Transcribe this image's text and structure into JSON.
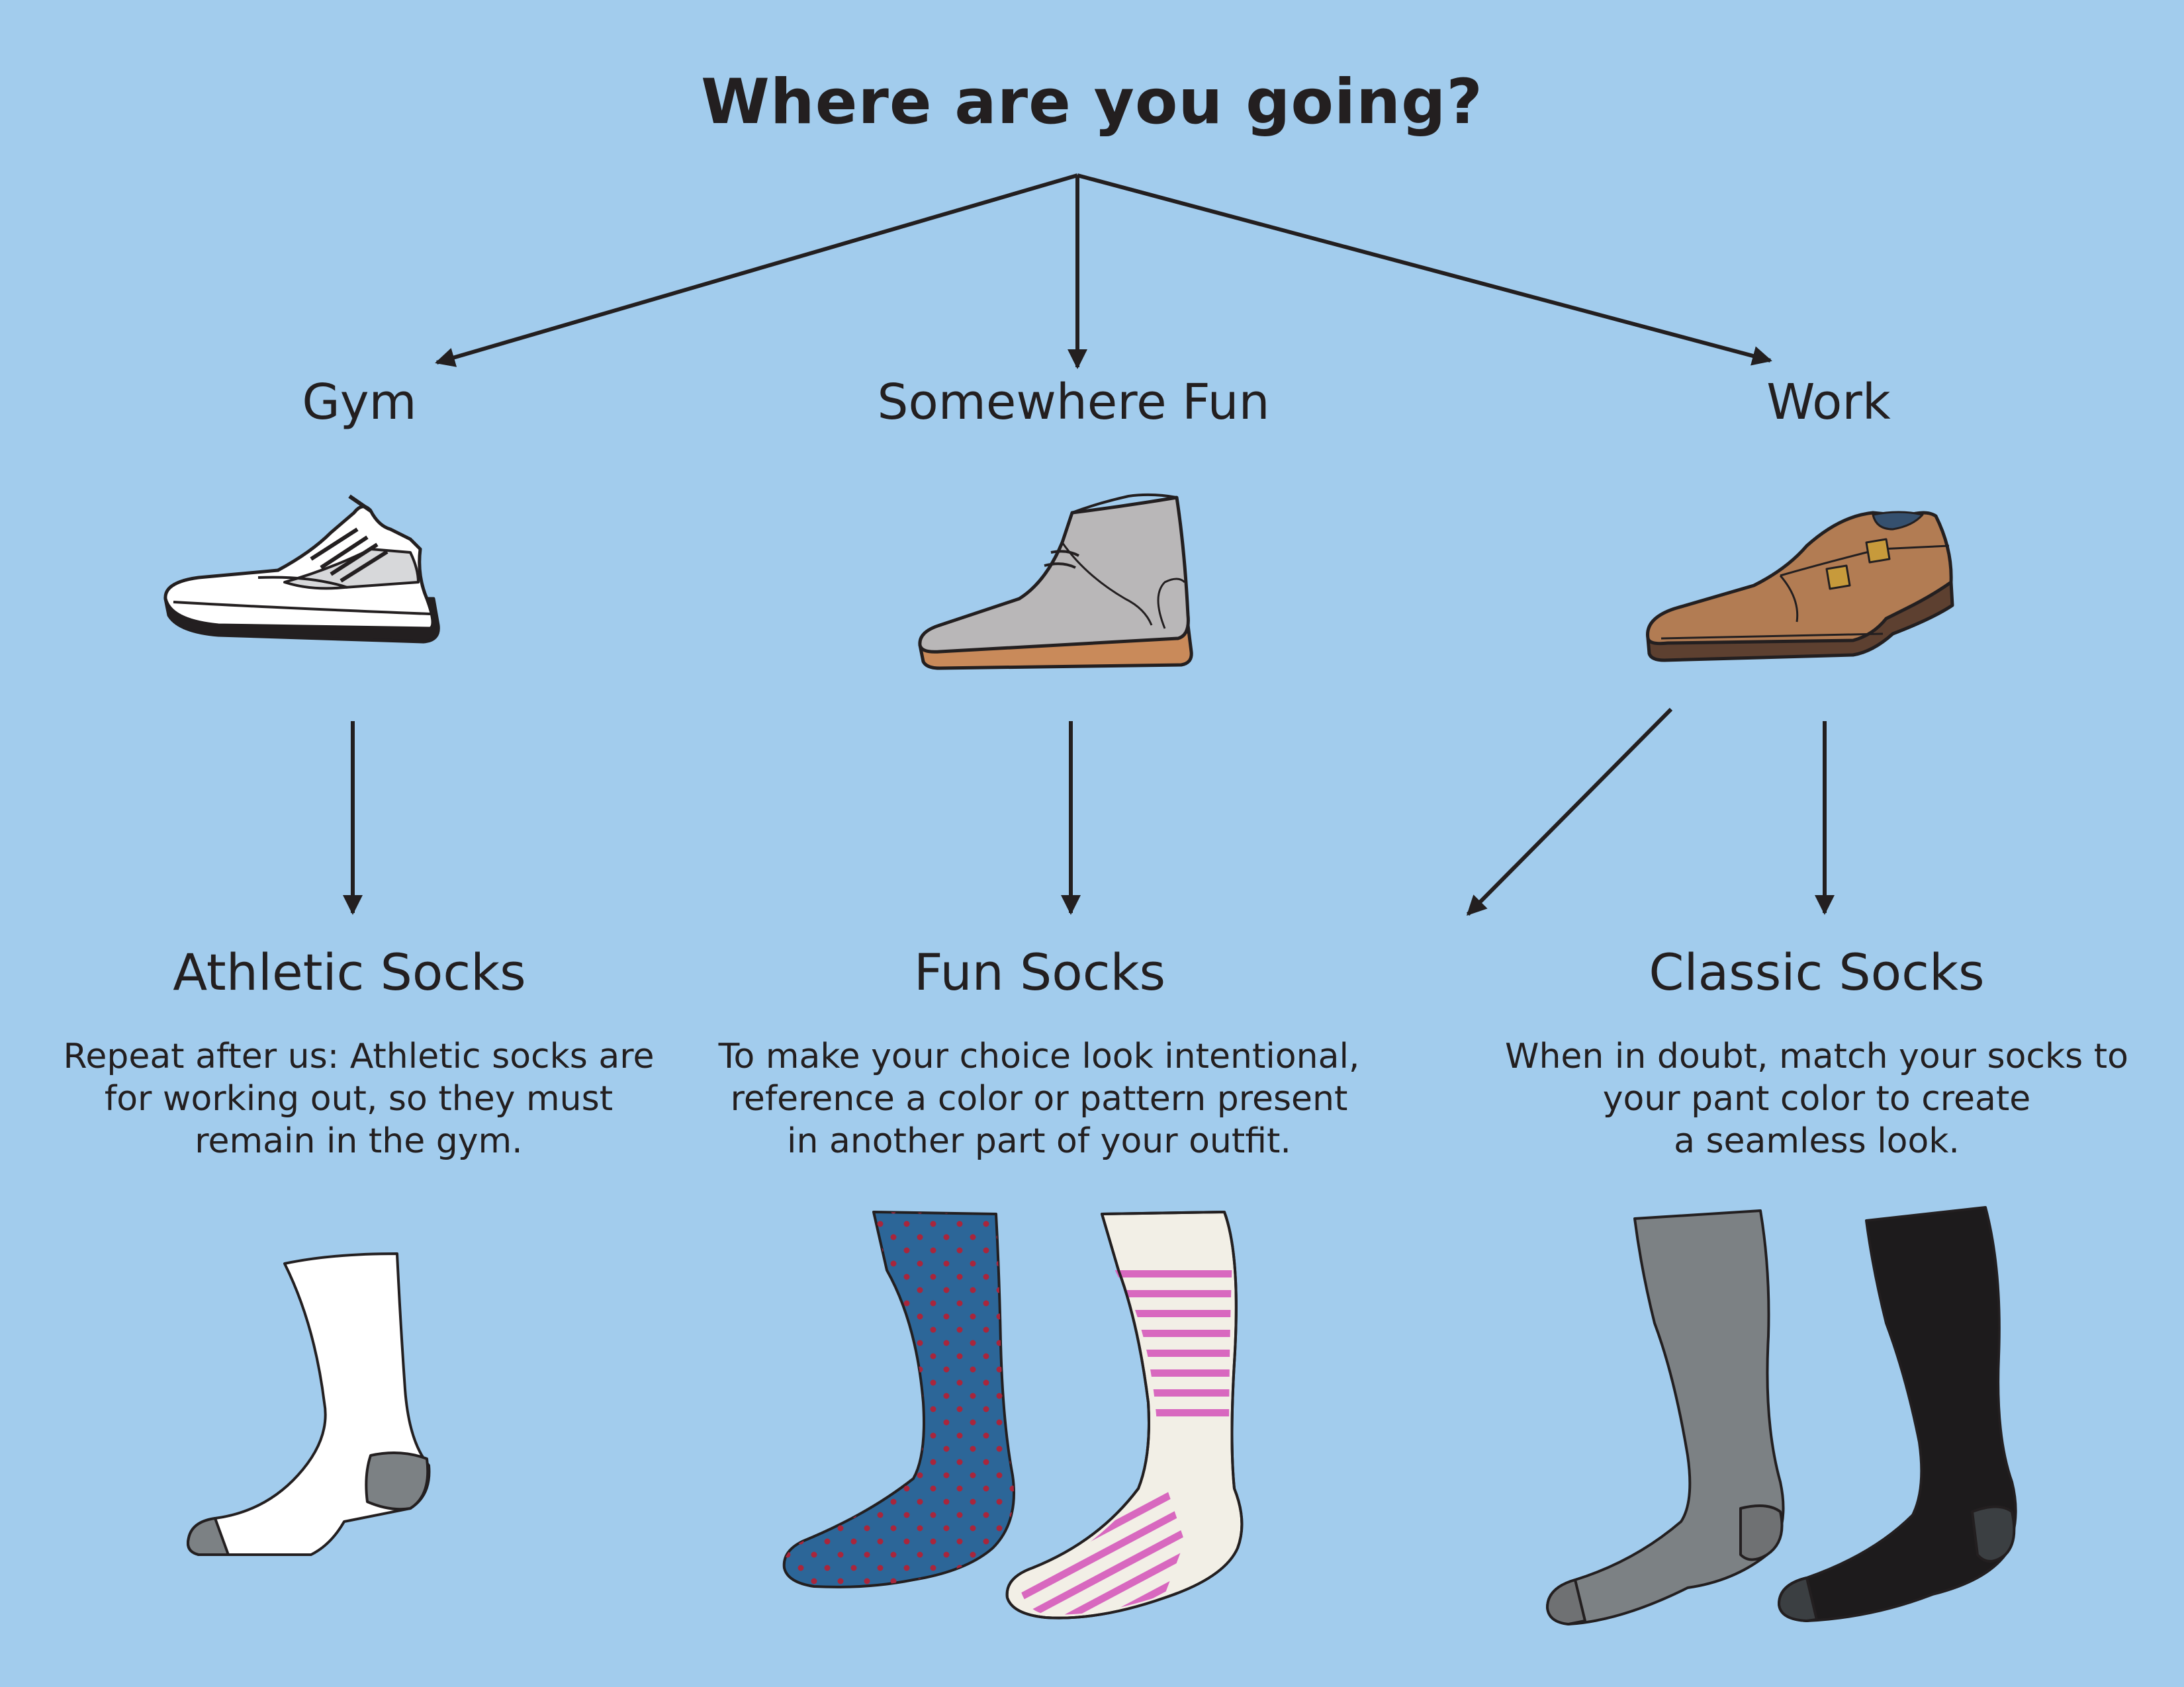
{
  "title": "Where are you going?",
  "branches": [
    {
      "label": "Gym",
      "shoe": "sneaker-icon"
    },
    {
      "label": "Somewhere Fun",
      "shoe": "chukka-boot-icon"
    },
    {
      "label": "Work",
      "shoe": "monk-strap-shoe-icon"
    }
  ],
  "categories": [
    {
      "label": "Athletic Socks",
      "desc": "Repeat after us: Athletic socks are\nfor working out, so they must\nremain in the gym."
    },
    {
      "label": "Fun Socks",
      "desc": "To make your choice look intentional,\nreference a color or pattern present\nin another part of your outfit."
    },
    {
      "label": "Classic Socks",
      "desc": "When in doubt, match your socks to\nyour pant color to create\na seamless look."
    }
  ],
  "colors": {
    "background": "#a2cced",
    "ink": "#231f20",
    "chukka": "#b9b7b8",
    "chukka_sole": "#c98a5a",
    "oxford": "#b27c53",
    "oxford_sole": "#5d4030",
    "sock_blue": "#2c6698",
    "sock_dots": "#a8263c",
    "sock_stripes": "#d868bf",
    "sock_cream": "#f2efe6",
    "sock_gray": "#7c8184",
    "sock_black": "#1d1b1c",
    "sock_toe_gray": "#6f7173"
  }
}
